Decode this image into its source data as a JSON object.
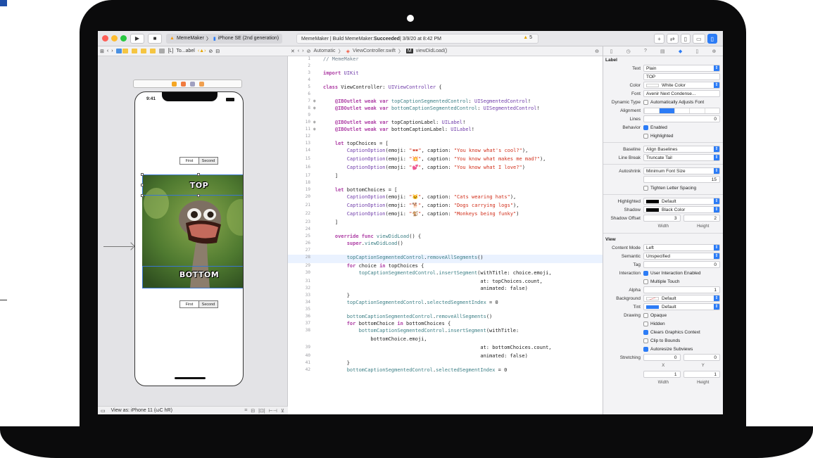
{
  "toolbar": {
    "scheme_app": "MemeMaker",
    "scheme_device": "iPhone SE (2nd generation)",
    "status_prefix": "MemeMaker | Build MemeMaker: ",
    "status_result": "Succeeded",
    "status_time": " | 3/9/20 at 8:42 PM",
    "warning_count": "5"
  },
  "canvas": {
    "breadcrumb_last": "To...abel",
    "phone_time": "9:41",
    "top_segment": [
      "First",
      "Second"
    ],
    "bottom_segment": [
      "First",
      "Second"
    ],
    "top_caption": "TOP",
    "bottom_caption": "BOTTOM",
    "view_as": "View as: iPhone 11 (ωC hR)"
  },
  "editor": {
    "jump_mode": "Automatic",
    "jump_file": "ViewController.swift",
    "jump_symbol": "viewDidLoad()",
    "lines": [
      {
        "n": "1",
        "t": "// MemeMaker",
        "c": "cm"
      },
      {
        "n": "2",
        "t": ""
      },
      {
        "n": "3",
        "t": "import UIKit"
      },
      {
        "n": "4",
        "t": ""
      },
      {
        "n": "5",
        "t": "class ViewController: UIViewController {"
      },
      {
        "n": "6",
        "t": ""
      },
      {
        "n": "7",
        "t": "    @IBOutlet weak var topCaptionSegmentedControl: UISegmentedControl!",
        "m": "◉"
      },
      {
        "n": "8",
        "t": "    @IBOutlet weak var bottomCaptionSegmentedControl: UISegmentedControl!",
        "m": "◉"
      },
      {
        "n": "9",
        "t": ""
      },
      {
        "n": "10",
        "t": "    @IBOutlet weak var topCaptionLabel: UILabel!",
        "m": "◉"
      },
      {
        "n": "11",
        "t": "    @IBOutlet weak var bottomCaptionLabel: UILabel!",
        "m": "◉"
      },
      {
        "n": "12",
        "t": ""
      },
      {
        "n": "13",
        "t": "    let topChoices = ["
      },
      {
        "n": "14",
        "t": "        CaptionOption(emoji: \"🕶\", caption: \"You know what's cool?\"),"
      },
      {
        "n": "15",
        "t": "        CaptionOption(emoji: \"💥\", caption: \"You know what makes me mad?\"),"
      },
      {
        "n": "16",
        "t": "        CaptionOption(emoji: \"💕\", caption: \"You know what I love?\")"
      },
      {
        "n": "17",
        "t": "    ]"
      },
      {
        "n": "18",
        "t": ""
      },
      {
        "n": "19",
        "t": "    let bottomChoices = ["
      },
      {
        "n": "20",
        "t": "        CaptionOption(emoji: \"🐱\", caption: \"Cats wearing hats\"),"
      },
      {
        "n": "21",
        "t": "        CaptionOption(emoji: \"🐕\", caption: \"Dogs carrying logs\"),"
      },
      {
        "n": "22",
        "t": "        CaptionOption(emoji: \"🐒\", caption: \"Monkeys being funky\")"
      },
      {
        "n": "23",
        "t": "    ]"
      },
      {
        "n": "24",
        "t": ""
      },
      {
        "n": "25",
        "t": "    override func viewDidLoad() {"
      },
      {
        "n": "26",
        "t": "        super.viewDidLoad()"
      },
      {
        "n": "27",
        "t": ""
      },
      {
        "n": "28",
        "t": "        topCaptionSegmentedControl.removeAllSegments()",
        "hl": true
      },
      {
        "n": "29",
        "t": "        for choice in topChoices {"
      },
      {
        "n": "30",
        "t": "            topCaptionSegmentedControl.insertSegment(withTitle: choice.emoji,"
      },
      {
        "n": "31",
        "t": "                                                     at: topChoices.count,"
      },
      {
        "n": "32",
        "t": "                                                     animated: false)"
      },
      {
        "n": "33",
        "t": "        }"
      },
      {
        "n": "34",
        "t": "        topCaptionSegmentedControl.selectedSegmentIndex = 0"
      },
      {
        "n": "35",
        "t": ""
      },
      {
        "n": "36",
        "t": "        bottomCaptionSegmentedControl.removeAllSegments()"
      },
      {
        "n": "37",
        "t": "        for bottomChoice in bottomChoices {"
      },
      {
        "n": "38",
        "t": "            bottomCaptionSegmentedControl.insertSegment(withTitle:"
      },
      {
        "n": "",
        "t": "                bottomChoice.emoji,"
      },
      {
        "n": "39",
        "t": "                                                     at: bottomChoices.count,"
      },
      {
        "n": "40",
        "t": "                                                     animated: false)"
      },
      {
        "n": "41",
        "t": "        }"
      },
      {
        "n": "42",
        "t": "        bottomCaptionSegmentedControl.selectedSegmentIndex = 0"
      }
    ]
  },
  "inspector": {
    "label_section": "Label",
    "text_label": "Text",
    "text_value": "Plain",
    "text_field": "TOP",
    "color_label": "Color",
    "color_value": "White Color",
    "font_label": "Font",
    "font_value": "Avenir Next Condense...",
    "dynamic_type_label": "Dynamic Type",
    "dynamic_type_value": "Automatically Adjusts Font",
    "alignment_label": "Alignment",
    "lines_label": "Lines",
    "lines_value": "0",
    "behavior_label": "Behavior",
    "behavior_enabled": "Enabled",
    "behavior_highlighted": "Highlighted",
    "baseline_label": "Baseline",
    "baseline_value": "Align Baselines",
    "linebreak_label": "Line Break",
    "linebreak_value": "Truncate Tail",
    "autoshrink_label": "Autoshrink",
    "autoshrink_value": "Minimum Font Size",
    "autoshrink_num": "15",
    "tighten": "Tighten Letter Spacing",
    "highlighted_label": "Highlighted",
    "highlighted_value": "Default",
    "shadow_label": "Shadow",
    "shadow_value": "Black Color",
    "shadow_offset_label": "Shadow Offset",
    "shadow_w": "3",
    "shadow_h": "2",
    "width_label": "Width",
    "height_label": "Height",
    "view_section": "View",
    "content_mode_label": "Content Mode",
    "content_mode_value": "Left",
    "semantic_label": "Semantic",
    "semantic_value": "Unspecified",
    "tag_label": "Tag",
    "tag_value": "0",
    "interaction_label": "Interaction",
    "interaction_1": "User Interaction Enabled",
    "interaction_2": "Multiple Touch",
    "alpha_label": "Alpha",
    "alpha_value": "1",
    "background_label": "Background",
    "background_value": "Default",
    "tint_label": "Tint",
    "tint_value": "Default",
    "drawing_label": "Drawing",
    "drawing_opaque": "Opaque",
    "drawing_hidden": "Hidden",
    "drawing_clears": "Clears Graphics Context",
    "drawing_clip": "Clip to Bounds",
    "drawing_autoresize": "Autoresize Subviews",
    "stretching_label": "Stretching",
    "stretch_x": "0",
    "stretch_y": "0",
    "x_label": "X",
    "y_label": "Y",
    "stretch_w": "1",
    "stretch_h": "1"
  },
  "colors": {
    "accent": "#2c7cf6",
    "success_text": "#222222",
    "warning": "#e6a500"
  }
}
